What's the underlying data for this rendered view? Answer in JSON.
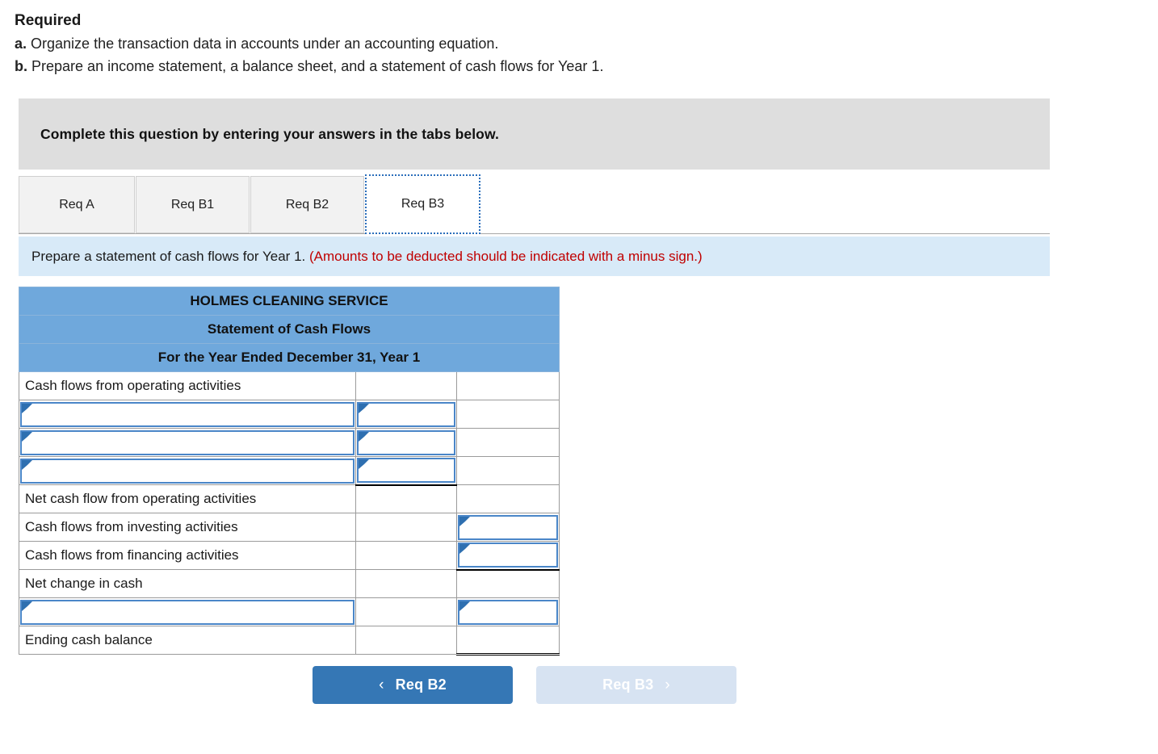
{
  "required": {
    "title": "Required",
    "items": [
      {
        "marker": "a.",
        "text": "Organize the transaction data in accounts under an accounting equation."
      },
      {
        "marker": "b.",
        "text": "Prepare an income statement, a balance sheet, and a statement of cash flows for Year 1."
      }
    ]
  },
  "banner": {
    "text": "Complete this question by entering your answers in the tabs below."
  },
  "tabs": [
    {
      "label": "Req A",
      "active": false
    },
    {
      "label": "Req B1",
      "active": false
    },
    {
      "label": "Req B2",
      "active": false
    },
    {
      "label": "Req B3",
      "active": true
    }
  ],
  "instruction": {
    "black_text": "Prepare a statement of cash flows for Year 1.",
    "red_text": "(Amounts to be deducted should be indicated with a minus sign.)",
    "red_color": "#c00000",
    "bar_color": "#d8eaf8"
  },
  "statement": {
    "header_color": "#6fa8dc",
    "titles": [
      "HOLMES CLEANING SERVICE",
      "Statement of Cash Flows",
      "For the Year Ended December 31, Year 1"
    ],
    "rows": [
      {
        "label": "Cash flows from operating activities",
        "label_input": false,
        "amt1": "",
        "amt2": "",
        "amt1_input": false,
        "amt2_input": false,
        "amt1_rule": "",
        "amt2_rule": ""
      },
      {
        "label": "",
        "label_input": true,
        "amt1": "",
        "amt2": "",
        "amt1_input": true,
        "amt2_input": false,
        "amt1_rule": "",
        "amt2_rule": ""
      },
      {
        "label": "",
        "label_input": true,
        "amt1": "",
        "amt2": "",
        "amt1_input": true,
        "amt2_input": false,
        "amt1_rule": "",
        "amt2_rule": ""
      },
      {
        "label": "",
        "label_input": true,
        "amt1": "",
        "amt2": "",
        "amt1_input": true,
        "amt2_input": false,
        "amt1_rule": "single",
        "amt2_rule": ""
      },
      {
        "label": "Net cash flow from operating activities",
        "label_input": false,
        "amt1": "",
        "amt2": "",
        "amt1_input": false,
        "amt2_input": false,
        "amt1_rule": "",
        "amt2_rule": ""
      },
      {
        "label": "Cash flows from investing activities",
        "label_input": false,
        "amt1": "",
        "amt2": "",
        "amt1_input": false,
        "amt2_input": true,
        "amt1_rule": "",
        "amt2_rule": ""
      },
      {
        "label": "Cash flows from financing activities",
        "label_input": false,
        "amt1": "",
        "amt2": "",
        "amt1_input": false,
        "amt2_input": true,
        "amt1_rule": "",
        "amt2_rule": "single"
      },
      {
        "label": "Net change in cash",
        "label_input": false,
        "amt1": "",
        "amt2": "",
        "amt1_input": false,
        "amt2_input": false,
        "amt1_rule": "",
        "amt2_rule": ""
      },
      {
        "label": "",
        "label_input": true,
        "amt1": "",
        "amt2": "",
        "amt1_input": false,
        "amt2_input": true,
        "amt1_rule": "",
        "amt2_rule": ""
      },
      {
        "label": "Ending cash balance",
        "label_input": false,
        "amt1": "",
        "amt2": "",
        "amt1_input": false,
        "amt2_input": false,
        "amt1_rule": "",
        "amt2_rule": "total"
      }
    ]
  },
  "navigation": {
    "prev": {
      "label": "Req B2",
      "icon": "chevron-left-icon",
      "glyph": "‹",
      "enabled": true,
      "color": "#3577b5"
    },
    "next": {
      "label": "Req B3",
      "icon": "chevron-right-icon",
      "glyph": "›",
      "enabled": false,
      "color": "#d7e3f2"
    }
  }
}
